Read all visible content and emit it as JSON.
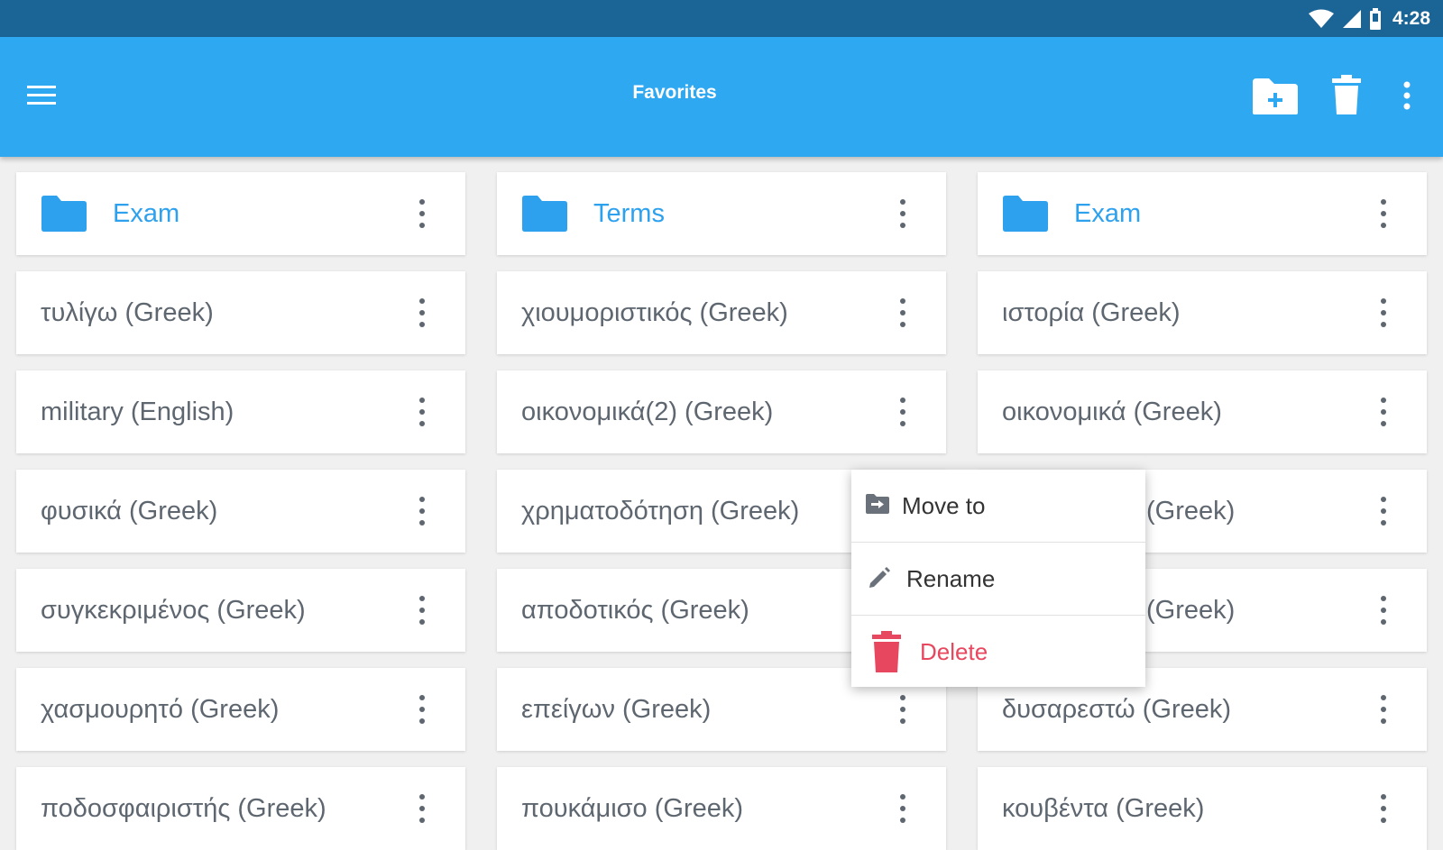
{
  "status_bar": {
    "time": "4:28"
  },
  "app_bar": {
    "title": "Favorites"
  },
  "icons": {
    "menu": "hamburger-menu-icon",
    "new_folder": "new-folder-icon",
    "delete": "trash-icon",
    "overflow": "more-vert-icon"
  },
  "grid": {
    "columns": [
      {
        "folder": "Exam",
        "items": [
          "τυλίγω (Greek)",
          "military (English)",
          "φυσικά (Greek)",
          "συγκεκριμένος (Greek)",
          "χασμουρητό (Greek)",
          "ποδοσφαιριστής (Greek)"
        ]
      },
      {
        "folder": "Terms",
        "items": [
          "χιουμοριστικός (Greek)",
          "οικονομικά(2) (Greek)",
          "χρηματοδότηση (Greek)",
          "αποδοτικός (Greek)",
          "επείγων (Greek)",
          "πουκάμισο (Greek)"
        ]
      },
      {
        "folder": "Exam",
        "items": [
          "ιστορία (Greek)",
          "οικονομικά (Greek)",
          "(Greek)",
          "(Greek)",
          "δυσαρεστώ (Greek)",
          "κουβέντα (Greek)"
        ]
      }
    ]
  },
  "context_menu": {
    "move_to": "Move to",
    "rename": "Rename",
    "delete": "Delete"
  },
  "colors": {
    "status_bar": "#1b6496",
    "app_bar": "#2ea8f1",
    "folder_accent": "#2ea1ee",
    "delete_accent": "#e8485f",
    "background": "#f0f0f0"
  }
}
